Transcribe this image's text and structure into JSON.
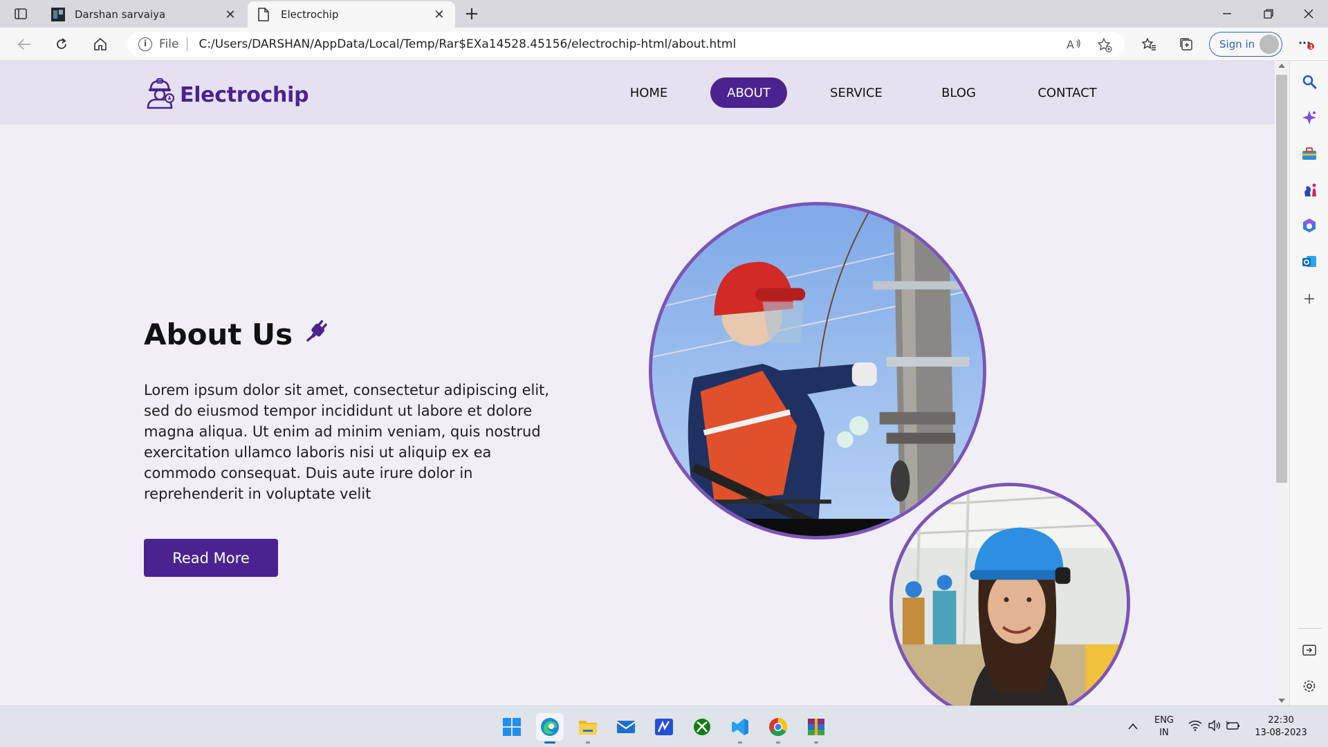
{
  "browser": {
    "tabs": [
      {
        "title": "Darshan sarvaiya",
        "active": false
      },
      {
        "title": "Electrochip",
        "active": true
      }
    ],
    "address": {
      "scheme_label": "File",
      "url": "C:/Users/DARSHAN/AppData/Local/Temp/Rar$EXa14528.45156/electrochip-html/about.html"
    },
    "signin_label": "Sign in",
    "accent": "#2f63c8"
  },
  "site": {
    "brand": "Electrochip",
    "brand_color": "#4b2390",
    "nav": [
      "HOME",
      "ABOUT",
      "SERVICE",
      "BLOG",
      "CONTACT"
    ],
    "active_nav": "ABOUT",
    "hero": {
      "title": "About Us",
      "body": "Lorem ipsum dolor sit amet, consectetur adipiscing elit, sed do eiusmod tempor incididunt ut labore et dolore magna aliqua. Ut enim ad minim veniam, quis nostrud exercitation ullamco laboris nisi ut aliquip ex ea commodo consequat. Duis aute irure dolor in reprehenderit in voluptate velit",
      "button": "Read More"
    },
    "images": [
      {
        "subject": "electrician-on-pole-photo"
      },
      {
        "subject": "woman-engineer-hard-hat-photo"
      }
    ]
  },
  "taskbar": {
    "apps": [
      "windows-start",
      "edge",
      "file-explorer",
      "mail",
      "notes",
      "xbox",
      "vscode",
      "chrome",
      "winrar"
    ],
    "language": {
      "line1": "ENG",
      "line2": "IN"
    },
    "clock": {
      "time": "22:30",
      "date": "13-08-2023"
    }
  }
}
